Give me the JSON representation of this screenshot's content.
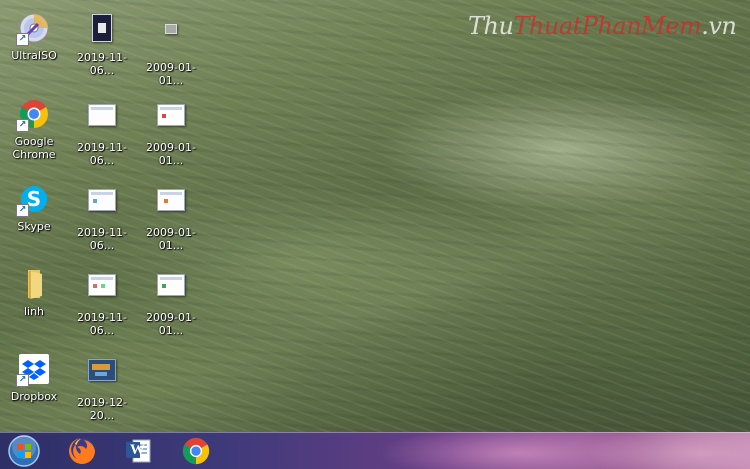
{
  "watermark": {
    "part1": "Thu",
    "part2": "ThuatPhanMem",
    "part3": ".vn"
  },
  "desktop": {
    "column1": [
      {
        "label": "UltraISO",
        "icon": "ultraiso-icon"
      },
      {
        "label": "Google\nChrome",
        "label_line1": "Google",
        "label_line2": "Chrome",
        "icon": "chrome-icon"
      },
      {
        "label": "Skype",
        "icon": "skype-icon"
      },
      {
        "label": "linh",
        "icon": "folder-icon"
      },
      {
        "label": "Dropbox",
        "icon": "dropbox-icon"
      }
    ],
    "column2": [
      {
        "label": "2019-11-06..."
      },
      {
        "label": "2019-11-06..."
      },
      {
        "label": "2019-11-06..."
      },
      {
        "label": "2019-11-06..."
      },
      {
        "label": "2019-12-20..."
      }
    ],
    "column3": [
      {
        "label": "2009-01-01..."
      },
      {
        "label": "2009-01-01..."
      },
      {
        "label": "2009-01-01..."
      },
      {
        "label": "2009-01-01..."
      }
    ]
  },
  "taskbar": {
    "items": [
      "start-orb-icon",
      "firefox-icon",
      "word-icon",
      "chrome-icon"
    ],
    "word_letter": "W"
  },
  "colors": {
    "taskbar_left": "#2d2f66",
    "taskbar_right": "#c48ab4",
    "watermark_red": "#d22828"
  }
}
